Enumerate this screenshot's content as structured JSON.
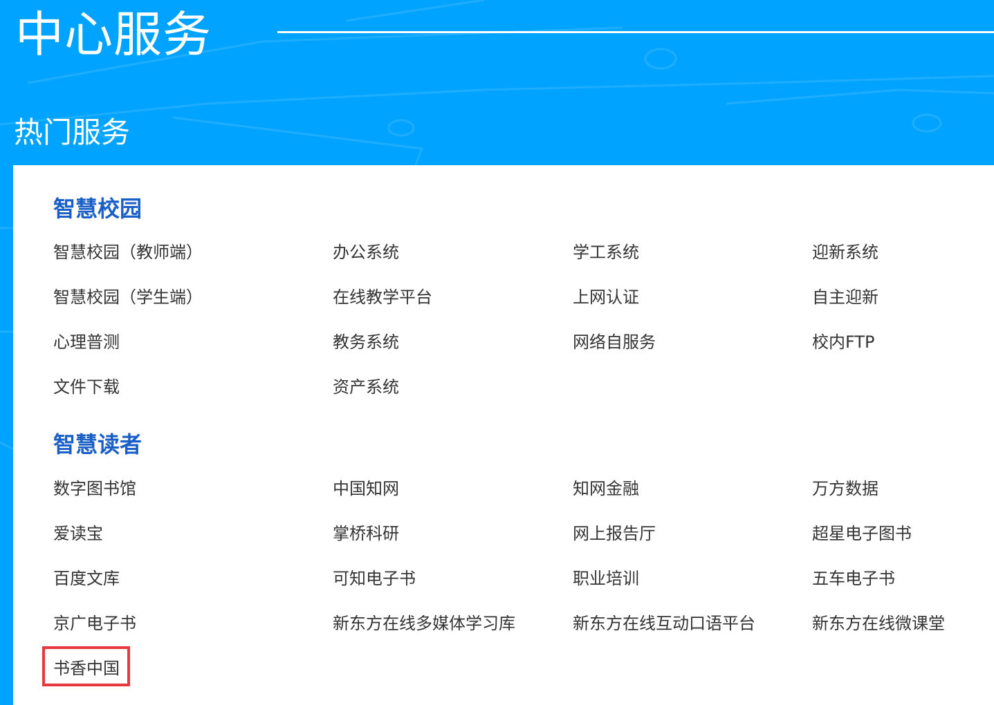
{
  "header": {
    "title": "中心服务",
    "subtitle": "热门服务"
  },
  "sections": [
    {
      "title": "智慧校园",
      "items": [
        "智慧校园（教师端）",
        "办公系统",
        "学工系统",
        "迎新系统",
        "智慧校园（学生端）",
        "在线教学平台",
        "上网认证",
        "自主迎新",
        "心理普测",
        "教务系统",
        "网络自服务",
        "校内FTP",
        "文件下载",
        "资产系统"
      ]
    },
    {
      "title": "智慧读者",
      "items": [
        "数字图书馆",
        "中国知网",
        "知网金融",
        "万方数据",
        "爱读宝",
        "掌桥科研",
        "网上报告厅",
        "超星电子图书",
        "百度文库",
        "可知电子书",
        "职业培训",
        "五车电子书",
        "京广电子书",
        "新东方在线多媒体学习库",
        "新东方在线互动口语平台",
        "新东方在线微课堂",
        "书香中国"
      ]
    }
  ],
  "colors": {
    "background": "#00a3ff",
    "panel": "#ffffff",
    "section_title": "#1a5fc8",
    "link_text": "#333333",
    "highlight_border": "#e8383d"
  }
}
